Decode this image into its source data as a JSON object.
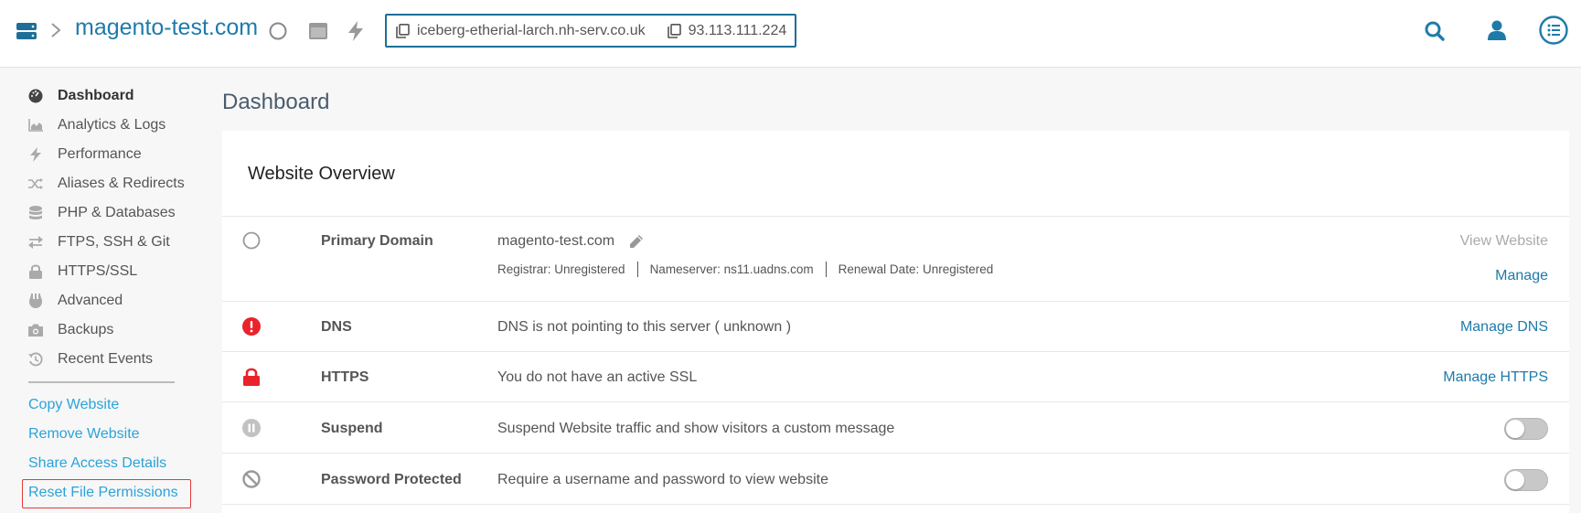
{
  "header": {
    "site_name": "magento-test.com",
    "hostname": "iceberg-etherial-larch.nh-serv.co.uk",
    "ip": "93.113.111.224"
  },
  "sidebar": {
    "items": [
      {
        "label": "Dashboard",
        "icon": "dashboard-icon",
        "active": true
      },
      {
        "label": "Analytics & Logs",
        "icon": "area-chart-icon"
      },
      {
        "label": "Performance",
        "icon": "bolt-icon"
      },
      {
        "label": "Aliases & Redirects",
        "icon": "shuffle-icon"
      },
      {
        "label": "PHP & Databases",
        "icon": "database-icon"
      },
      {
        "label": "FTPS, SSH & Git",
        "icon": "exchange-icon"
      },
      {
        "label": "HTTPS/SSL",
        "icon": "lock-icon"
      },
      {
        "label": "Advanced",
        "icon": "advanced-icon"
      },
      {
        "label": "Backups",
        "icon": "camera-icon"
      },
      {
        "label": "Recent Events",
        "icon": "history-icon"
      }
    ],
    "actions": [
      {
        "label": "Copy Website"
      },
      {
        "label": "Remove Website"
      },
      {
        "label": "Share Access Details"
      },
      {
        "label": "Reset File Permissions",
        "highlighted": true
      }
    ]
  },
  "main": {
    "title": "Dashboard",
    "overview": {
      "title": "Website Overview",
      "primary_domain": {
        "label": "Primary Domain",
        "value": "magento-test.com",
        "registrar": "Registrar: Unregistered",
        "nameserver": "Nameserver: ns11.uadns.com",
        "renewal": "Renewal Date: Unregistered",
        "view_label": "View Website",
        "manage_label": "Manage"
      },
      "dns": {
        "label": "DNS",
        "desc": "DNS is not pointing to this server ( unknown )",
        "action": "Manage DNS"
      },
      "https": {
        "label": "HTTPS",
        "desc": "You do not have an active SSL",
        "action": "Manage HTTPS"
      },
      "suspend": {
        "label": "Suspend",
        "desc": "Suspend Website traffic and show visitors a custom message",
        "enabled": false
      },
      "password": {
        "label": "Password Protected",
        "desc": "Require a username and password to view website",
        "enabled": false
      }
    }
  },
  "colors": {
    "brand": "#1e7ba9",
    "link": "#2aa3d9",
    "danger": "#e8232b",
    "highlight_border": "#e23a3a"
  }
}
